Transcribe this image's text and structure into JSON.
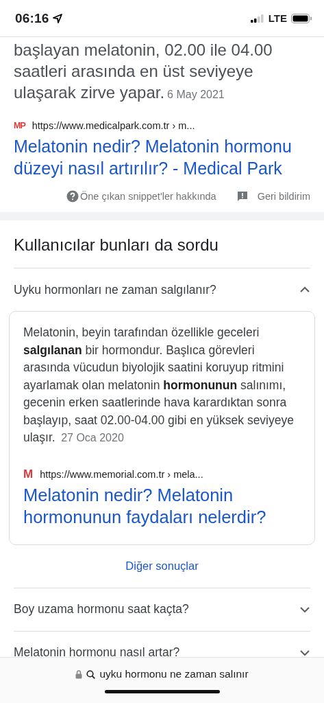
{
  "status_bar": {
    "time": "06:16",
    "network": "LTE"
  },
  "snippet": {
    "text": "başlayan melatonin, 02.00 ile 04.00 saatleri arasında en üst seviyeye ulaşarak zirve yapar.",
    "date": "6 May 2021",
    "source": {
      "favicon": "MP",
      "url": "https://www.medicalpark.com.tr › m..."
    },
    "title": "Melatonin nedir? Melatonin hormonu düzeyi nasıl artırılır? - Medical Park"
  },
  "feedback": {
    "about": "Öne çıkan snippet'ler hakkında",
    "feedback": "Geri bildirim"
  },
  "people_also_ask": {
    "heading": "Kullanıcılar bunları da sordu",
    "questions": [
      {
        "question": "Uyku hormonları ne zaman salgılanır?",
        "expanded": true,
        "answer": {
          "text": "Melatonin, beyin tarafından özellikle geceleri **salgılanan** bir hormondur. Başlıca görevleri arasında vücudun biyolojik saatini koruyup ritmini ayarlamak olan melatonin **hormonunun** salınımı, gecenin erken saatlerinde hava karardıktan sonra başlayıp, saat 02.00-04.00 gibi en yüksek seviyeye ulaşır.",
          "date": "27 Oca 2020",
          "source": {
            "favicon": "M",
            "url": "https://www.memorial.com.tr › mela..."
          },
          "title": "Melatonin nedir? Melatonin hormonunun faydaları nelerdir?"
        }
      },
      {
        "question": "Boy uzama hormonu saat kaçta?",
        "expanded": false
      },
      {
        "question": "Melatonin hormonu nasıl artar?",
        "expanded": false
      }
    ],
    "more": "Diğer sonuçlar"
  },
  "address_bar": {
    "url": "uyku hormonu ne zaman salınır"
  }
}
